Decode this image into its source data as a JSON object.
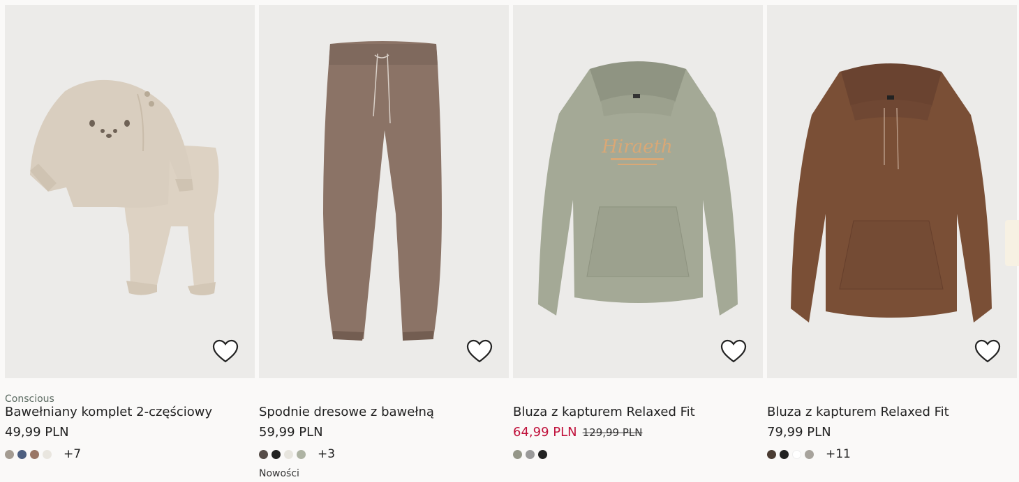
{
  "products": [
    {
      "marker": "Conscious",
      "title": "Bawełniany komplet 2-częściowy",
      "price": "49,99 PLN",
      "sale_price": "",
      "old_price": "",
      "swatches": [
        "#a49c92",
        "#4d5f80",
        "#9a7766",
        "#e9e6df"
      ],
      "more_colors": "+7",
      "badge": "",
      "image": "baby-set-image"
    },
    {
      "marker": "",
      "title": "Spodnie dresowe z bawełną",
      "price": "59,99 PLN",
      "sale_price": "",
      "old_price": "",
      "swatches": [
        "#564d48",
        "#222222",
        "#e7e5de",
        "#aeb3a3"
      ],
      "more_colors": "+3",
      "badge": "Nowości",
      "image": "sweatpants-image"
    },
    {
      "marker": "",
      "title": "Bluza z kapturem Relaxed Fit",
      "price": "",
      "sale_price": "64,99 PLN",
      "old_price": "129,99 PLN",
      "swatches": [
        "#959789",
        "#9a9a9a",
        "#222222"
      ],
      "more_colors": "",
      "badge": "",
      "image": "sage-hoodie-image"
    },
    {
      "marker": "",
      "title": "Bluza z kapturem Relaxed Fit",
      "price": "79,99 PLN",
      "sale_price": "",
      "old_price": "",
      "swatches": [
        "#4a3c33",
        "#222222",
        "#ffffff",
        "#a7a39c"
      ],
      "more_colors": "+11",
      "badge": "",
      "image": "brown-hoodie-image"
    }
  ],
  "colors": {
    "sale": "#c0113b",
    "marker": "#5c6b62",
    "image_bg": "#ecebe9"
  }
}
